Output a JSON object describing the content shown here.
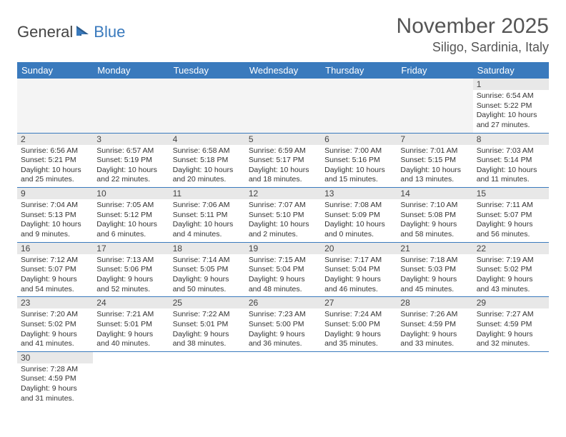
{
  "logo": {
    "part1": "General",
    "part2": "Blue"
  },
  "title": "November 2025",
  "location": "Siligo, Sardinia, Italy",
  "weekdays": [
    "Sunday",
    "Monday",
    "Tuesday",
    "Wednesday",
    "Thursday",
    "Friday",
    "Saturday"
  ],
  "weeks": [
    [
      null,
      null,
      null,
      null,
      null,
      null,
      {
        "d": "1",
        "sr": "6:54 AM",
        "ss": "5:22 PM",
        "dl": "10 hours and 27 minutes."
      }
    ],
    [
      {
        "d": "2",
        "sr": "6:56 AM",
        "ss": "5:21 PM",
        "dl": "10 hours and 25 minutes."
      },
      {
        "d": "3",
        "sr": "6:57 AM",
        "ss": "5:19 PM",
        "dl": "10 hours and 22 minutes."
      },
      {
        "d": "4",
        "sr": "6:58 AM",
        "ss": "5:18 PM",
        "dl": "10 hours and 20 minutes."
      },
      {
        "d": "5",
        "sr": "6:59 AM",
        "ss": "5:17 PM",
        "dl": "10 hours and 18 minutes."
      },
      {
        "d": "6",
        "sr": "7:00 AM",
        "ss": "5:16 PM",
        "dl": "10 hours and 15 minutes."
      },
      {
        "d": "7",
        "sr": "7:01 AM",
        "ss": "5:15 PM",
        "dl": "10 hours and 13 minutes."
      },
      {
        "d": "8",
        "sr": "7:03 AM",
        "ss": "5:14 PM",
        "dl": "10 hours and 11 minutes."
      }
    ],
    [
      {
        "d": "9",
        "sr": "7:04 AM",
        "ss": "5:13 PM",
        "dl": "10 hours and 9 minutes."
      },
      {
        "d": "10",
        "sr": "7:05 AM",
        "ss": "5:12 PM",
        "dl": "10 hours and 6 minutes."
      },
      {
        "d": "11",
        "sr": "7:06 AM",
        "ss": "5:11 PM",
        "dl": "10 hours and 4 minutes."
      },
      {
        "d": "12",
        "sr": "7:07 AM",
        "ss": "5:10 PM",
        "dl": "10 hours and 2 minutes."
      },
      {
        "d": "13",
        "sr": "7:08 AM",
        "ss": "5:09 PM",
        "dl": "10 hours and 0 minutes."
      },
      {
        "d": "14",
        "sr": "7:10 AM",
        "ss": "5:08 PM",
        "dl": "9 hours and 58 minutes."
      },
      {
        "d": "15",
        "sr": "7:11 AM",
        "ss": "5:07 PM",
        "dl": "9 hours and 56 minutes."
      }
    ],
    [
      {
        "d": "16",
        "sr": "7:12 AM",
        "ss": "5:07 PM",
        "dl": "9 hours and 54 minutes."
      },
      {
        "d": "17",
        "sr": "7:13 AM",
        "ss": "5:06 PM",
        "dl": "9 hours and 52 minutes."
      },
      {
        "d": "18",
        "sr": "7:14 AM",
        "ss": "5:05 PM",
        "dl": "9 hours and 50 minutes."
      },
      {
        "d": "19",
        "sr": "7:15 AM",
        "ss": "5:04 PM",
        "dl": "9 hours and 48 minutes."
      },
      {
        "d": "20",
        "sr": "7:17 AM",
        "ss": "5:04 PM",
        "dl": "9 hours and 46 minutes."
      },
      {
        "d": "21",
        "sr": "7:18 AM",
        "ss": "5:03 PM",
        "dl": "9 hours and 45 minutes."
      },
      {
        "d": "22",
        "sr": "7:19 AM",
        "ss": "5:02 PM",
        "dl": "9 hours and 43 minutes."
      }
    ],
    [
      {
        "d": "23",
        "sr": "7:20 AM",
        "ss": "5:02 PM",
        "dl": "9 hours and 41 minutes."
      },
      {
        "d": "24",
        "sr": "7:21 AM",
        "ss": "5:01 PM",
        "dl": "9 hours and 40 minutes."
      },
      {
        "d": "25",
        "sr": "7:22 AM",
        "ss": "5:01 PM",
        "dl": "9 hours and 38 minutes."
      },
      {
        "d": "26",
        "sr": "7:23 AM",
        "ss": "5:00 PM",
        "dl": "9 hours and 36 minutes."
      },
      {
        "d": "27",
        "sr": "7:24 AM",
        "ss": "5:00 PM",
        "dl": "9 hours and 35 minutes."
      },
      {
        "d": "28",
        "sr": "7:26 AM",
        "ss": "4:59 PM",
        "dl": "9 hours and 33 minutes."
      },
      {
        "d": "29",
        "sr": "7:27 AM",
        "ss": "4:59 PM",
        "dl": "9 hours and 32 minutes."
      }
    ],
    [
      {
        "d": "30",
        "sr": "7:28 AM",
        "ss": "4:59 PM",
        "dl": "9 hours and 31 minutes."
      },
      null,
      null,
      null,
      null,
      null,
      null
    ]
  ],
  "labels": {
    "sunrise": "Sunrise: ",
    "sunset": "Sunset: ",
    "daylight": "Daylight: "
  }
}
